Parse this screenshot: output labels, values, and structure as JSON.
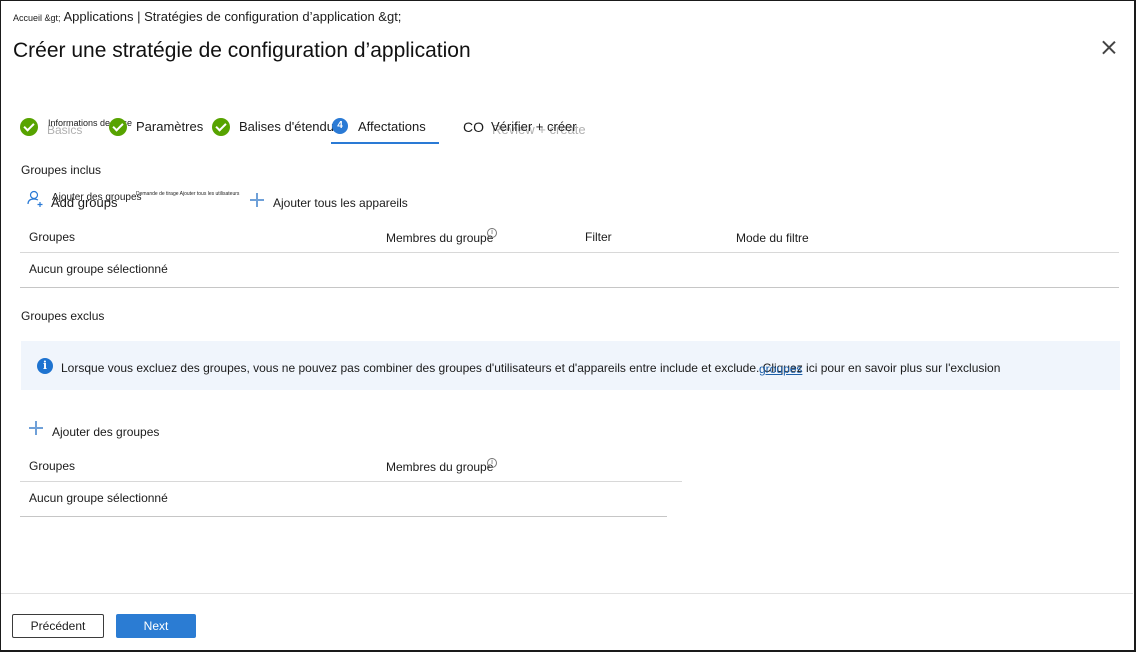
{
  "breadcrumb": {
    "home": "Accueil &gt;",
    "path": "Applications | Stratégies de configuration d’application &gt;"
  },
  "header": {
    "title": "Créer une stratégie de configuration d’application"
  },
  "steps": [
    {
      "label": "Informations de base",
      "ghost": "Basics",
      "status": "complete"
    },
    {
      "label": "Paramètres",
      "status": "complete"
    },
    {
      "label": "Balises d'étendue",
      "status": "complete"
    },
    {
      "number": "4",
      "label": "Affectations",
      "status": "current"
    },
    {
      "prefix": "CO",
      "label": "Vérifier + créer",
      "ghost": "Review + create",
      "status": "pending"
    }
  ],
  "included": {
    "heading": "Groupes inclus",
    "add_groups": "Ajouter des groupes",
    "add_groups_ghost": "Add groups",
    "add_all_users": "Demande de tirage Ajouter tous les utilisateurs",
    "add_all_devices": "Ajouter tous les appareils",
    "columns": [
      "Groupes",
      "Membres du groupe",
      "Filter",
      "Mode du filtre"
    ],
    "empty_row": "Aucun groupe sélectionné"
  },
  "excluded": {
    "heading": "Groupes exclus",
    "banner_text": "Lorsque vous excluez des groupes, vous ne pouvez pas combiner des groupes d'utilisateurs et d'appareils entre include et exclude. Cliquez ici pour en savoir plus sur l'exclusion",
    "banner_link_overlay": "groupes",
    "add_groups": "Ajouter des groupes",
    "columns": [
      "Groupes",
      "Membres du groupe"
    ],
    "empty_row": "Aucun groupe sélectionné"
  },
  "footer": {
    "previous": "Précédent",
    "next": "Next"
  },
  "colors": {
    "accent": "#2b7cd3",
    "success": "#57a300",
    "banner_bg": "#f0f5fc"
  }
}
